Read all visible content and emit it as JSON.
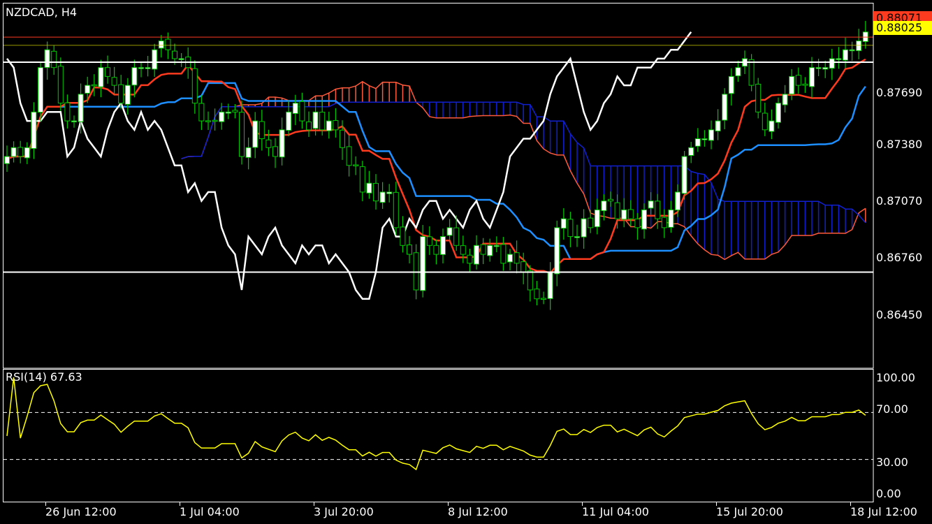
{
  "symbol_label": "NZDCAD, H4",
  "indicator_label": "RSI(14) 67.63",
  "current_prices": {
    "ask": {
      "text": "0.88071",
      "bg": "#ff3b1f",
      "color": "#000000"
    },
    "bid": {
      "text": "0.88025",
      "bg": "#ffff00",
      "color": "#000000"
    }
  },
  "colors": {
    "background": "#000000",
    "grid_frame": "#ffffff",
    "candle_up_wick": "#00c800",
    "candle_body": "#ffffff",
    "tenkan": "#ff3b1f",
    "kijun": "#1e8fff",
    "chikou": "#ffffff",
    "cloud_bull": "#ff5a3c",
    "cloud_bear": "#1020d0",
    "rsi_line": "#ffff00",
    "rsi_levels": "#ffffff"
  },
  "price_axis": {
    "ticks": [
      "0.87690",
      "0.87380",
      "0.87070",
      "0.86760",
      "0.86450"
    ]
  },
  "rsi_axis": {
    "ticks": [
      "100.00",
      "70.00",
      "30.00",
      "0.00"
    ]
  },
  "time_axis": {
    "ticks": [
      "26 Jun 12:00",
      "1 Jul 04:00",
      "3 Jul 20:00",
      "8 Jul 12:00",
      "11 Jul 04:00",
      "15 Jul 20:00",
      "18 Jul 12:00"
    ]
  },
  "chart_data": [
    {
      "type": "candlestick",
      "title": "NZDCAD, H4",
      "ylim": [
        0.8621,
        0.8826
      ],
      "horizontal_lines": [
        0.88071,
        0.88025,
        0.8793,
        0.8675
      ],
      "close": [
        0.874,
        0.8745,
        0.874,
        0.8745,
        0.8765,
        0.879,
        0.88,
        0.879,
        0.877,
        0.876,
        0.876,
        0.8775,
        0.878,
        0.878,
        0.879,
        0.8785,
        0.878,
        0.877,
        0.878,
        0.879,
        0.879,
        0.879,
        0.88,
        0.8805,
        0.88,
        0.8795,
        0.8795,
        0.879,
        0.877,
        0.876,
        0.876,
        0.876,
        0.8765,
        0.8765,
        0.8765,
        0.874,
        0.8745,
        0.876,
        0.875,
        0.8745,
        0.874,
        0.8755,
        0.8765,
        0.877,
        0.876,
        0.8755,
        0.8765,
        0.8755,
        0.876,
        0.8755,
        0.8745,
        0.8735,
        0.8735,
        0.872,
        0.8725,
        0.8715,
        0.872,
        0.872,
        0.87,
        0.869,
        0.8685,
        0.8665,
        0.8695,
        0.869,
        0.8685,
        0.8695,
        0.87,
        0.869,
        0.8685,
        0.868,
        0.869,
        0.8685,
        0.869,
        0.869,
        0.868,
        0.8685,
        0.868,
        0.8675,
        0.8665,
        0.866,
        0.866,
        0.8675,
        0.87,
        0.8705,
        0.8695,
        0.8695,
        0.8705,
        0.87,
        0.871,
        0.8715,
        0.8715,
        0.8705,
        0.871,
        0.8705,
        0.87,
        0.871,
        0.8715,
        0.8705,
        0.87,
        0.871,
        0.872,
        0.874,
        0.8745,
        0.875,
        0.875,
        0.8755,
        0.876,
        0.8775,
        0.8785,
        0.879,
        0.8795,
        0.878,
        0.8765,
        0.8755,
        0.876,
        0.877,
        0.8775,
        0.8785,
        0.878,
        0.878,
        0.879,
        0.879,
        0.879,
        0.8795,
        0.8795,
        0.88,
        0.88,
        0.8805,
        0.881
      ]
    },
    {
      "type": "line",
      "title": "RSI(14) 67.63",
      "ylim": [
        0,
        100
      ],
      "levels": [
        30,
        70
      ],
      "last_value": 67.63
    }
  ]
}
